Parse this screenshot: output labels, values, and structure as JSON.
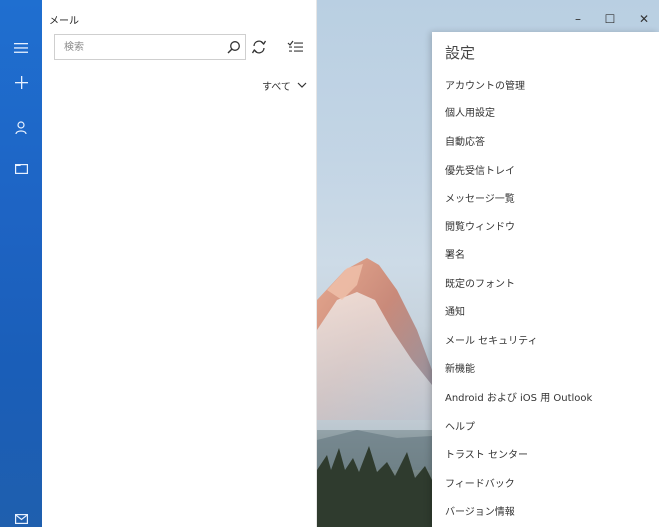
{
  "app": {
    "title": "メール"
  },
  "rail": {
    "icons": [
      "hamburger-icon",
      "plus-icon",
      "person-icon",
      "folder-icon",
      "mail-icon"
    ]
  },
  "search": {
    "placeholder": "検索",
    "value": ""
  },
  "filter": {
    "label": "すべて"
  },
  "window_controls": {
    "minimize": "–",
    "maximize": "☐",
    "close": "✕"
  },
  "settings": {
    "title": "設定",
    "items": [
      "アカウントの管理",
      "個人用設定",
      "自動応答",
      "優先受信トレイ",
      "メッセージ一覧",
      "閲覧ウィンドウ",
      "署名",
      "既定のフォント",
      "通知",
      "メール セキュリティ",
      "新機能",
      "Android および iOS 用 Outlook",
      "ヘルプ",
      "トラスト センター",
      "フィードバック",
      "バージョン情報"
    ]
  },
  "colors": {
    "rail": "#1e64c4",
    "pane": "#ffffff",
    "flyout": "#ffffff"
  }
}
